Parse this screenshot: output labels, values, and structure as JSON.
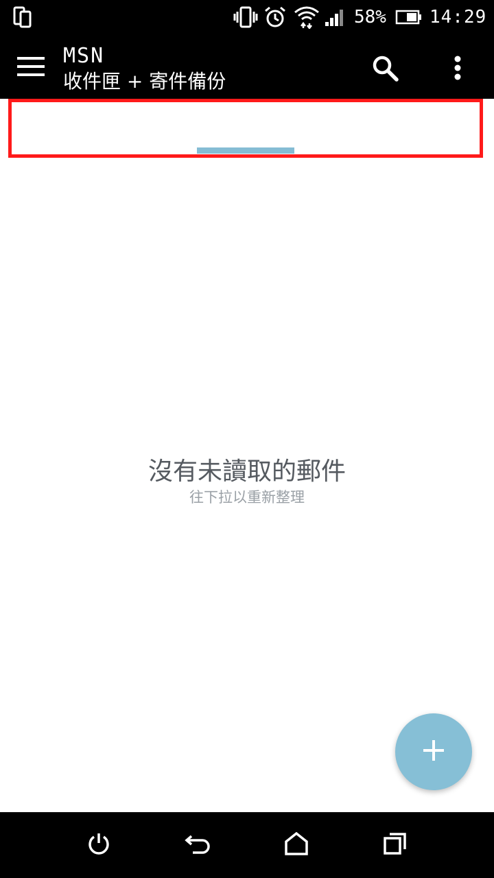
{
  "status_bar": {
    "battery_percent": "58%",
    "time": "14:29",
    "icons": [
      "screen-rotate-icon",
      "vibrate-icon",
      "alarm-icon",
      "wifi-icon",
      "signal-icon",
      "battery-icon"
    ]
  },
  "app_bar": {
    "account": "MSN",
    "folder": "收件匣 + 寄件備份",
    "icons": [
      "menu-icon",
      "search-icon",
      "more-vert-icon"
    ]
  },
  "empty_state": {
    "title": "沒有未讀取的郵件",
    "hint": "往下拉以重新整理"
  },
  "loading": {
    "progress_color": "#85bcd4"
  },
  "fab": {
    "icon": "plus-icon",
    "color": "#86bfd6"
  },
  "nav_bar": {
    "icons": [
      "power-icon",
      "back-icon",
      "home-icon",
      "recents-icon"
    ]
  },
  "colors": {
    "bar_background": "#000000",
    "highlight_border": "#ff1a1a"
  }
}
